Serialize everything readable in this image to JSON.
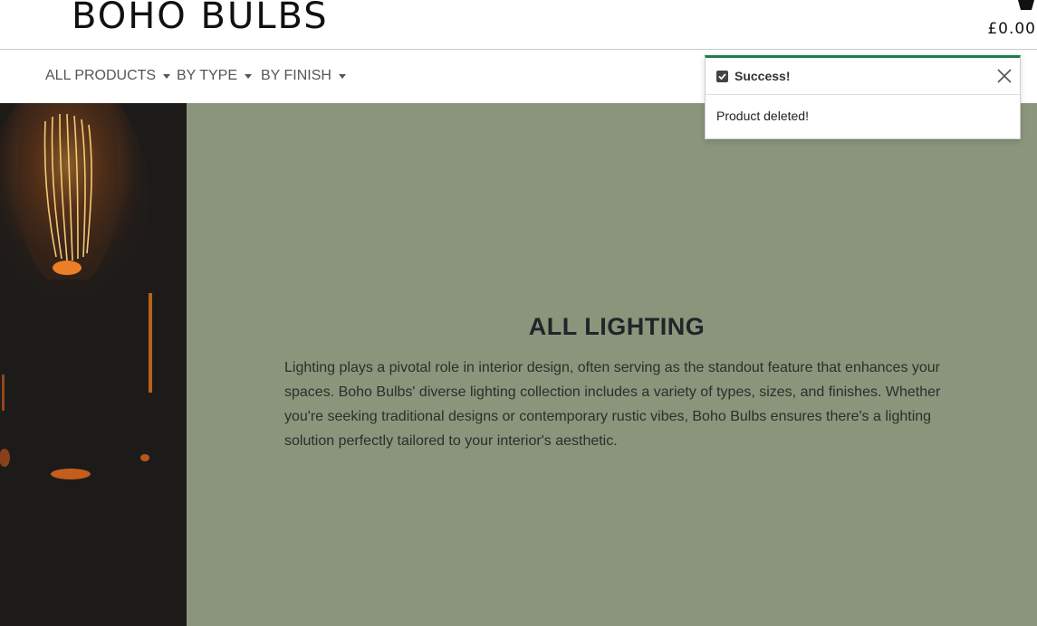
{
  "header": {
    "brand": "BOHO BULBS",
    "cart_icon": "basket-icon",
    "cart_total": "£0.00"
  },
  "nav": {
    "items": [
      {
        "label": "ALL PRODUCTS"
      },
      {
        "label": "BY TYPE"
      },
      {
        "label": "BY FINISH"
      }
    ]
  },
  "hero": {
    "title": "ALL LIGHTING",
    "text": "Lighting plays a pivotal role in interior design, often serving as the standout feature that enhances your spaces. Boho Bulbs' diverse lighting collection includes a variety of types, sizes, and finishes. Whether you're seeking traditional designs or contemporary rustic vibes, Boho Bulbs ensures there's a lighting solution perfectly tailored to your interior's aesthetic.",
    "background": "#8b957c"
  },
  "toast": {
    "title": "Success!",
    "message": "Product deleted!",
    "icon": "check-square-icon",
    "accent": "#1e7d4f"
  }
}
